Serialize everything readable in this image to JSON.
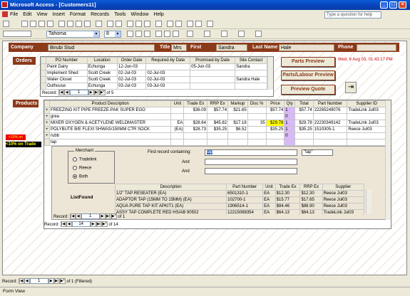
{
  "window": {
    "title": "Microsoft Access - [Customers11]"
  },
  "menu": [
    "File",
    "Edit",
    "View",
    "Insert",
    "Format",
    "Records",
    "Tools",
    "Window",
    "Help"
  ],
  "help_placeholder": "Type a question for help",
  "toolbar": {
    "font": "Tahoma",
    "size": "8"
  },
  "header": {
    "company_label": "Company Name",
    "company": "Birubi Stud",
    "title_label": "Title",
    "title": "Mrs",
    "first_label": "First Name",
    "first": "Sandra",
    "last_label": "Last Name",
    "last": "Hale",
    "phone_label": "Phone",
    "phone": ""
  },
  "orders": {
    "label": "Orders",
    "columns": [
      "PO Number",
      "Location",
      "Order Date",
      "Required-by Date",
      "Promised-by Date",
      "Site Contact"
    ],
    "rows": [
      [
        "Paint Dairy",
        "Echunga",
        "12-Jun-03",
        "",
        "05-Jun-03",
        "Sandra"
      ],
      [
        "Implement Shed",
        "Scott Creek",
        "02-Jul-03",
        "02-Jul-03",
        "",
        ""
      ],
      [
        "Water Closet",
        "Scott Creek",
        "02-Jul-03",
        "02-Jul-03",
        "",
        "Sandra Hale"
      ],
      [
        "Outhouse",
        "Echunga",
        "03-Jul-03",
        "03-Jul-03",
        "",
        ""
      ]
    ],
    "nav": {
      "record_label": "Record:",
      "current": "1",
      "of": "of 5"
    }
  },
  "buttons": {
    "parts_preview": "Parts Preview",
    "parts_labour": "Parts/Labour Preview",
    "preview_quote": "Preview Quote"
  },
  "datetime": "Wed, 6 Aug 03, 01:43:17 PM",
  "products": {
    "label": "Products",
    "columns": [
      "Product Description",
      "Unit",
      "Trade Ex",
      "RRP Ex",
      "Markup",
      "Disc %",
      "Price",
      "Qty",
      "Total",
      "Part Number",
      "Supplier ID"
    ],
    "rows": [
      [
        "FREEZING KIT PIPE FREEZE-PAK SUPER EGO",
        "",
        "$36.09",
        "$57.74",
        "$21.65",
        "",
        "$57.74",
        "1",
        "$57.74",
        "22265249076",
        "TradeLink Jul03"
      ],
      [
        "grea",
        "",
        "",
        "",
        "",
        "",
        "",
        "0",
        "",
        "",
        ""
      ],
      [
        "MIXER OXYGEN & ACETYLENE WELDMASTER",
        "EA",
        "$28.64",
        "$45.82",
        "$17.18",
        "35",
        "$29.78",
        "1",
        "$29.78",
        "22230349142",
        "TradeLink Jul03"
      ],
      [
        "POLYBUTE B/E FLEXI SHWAS/150MM CTR SOCK",
        "(EA)",
        "$28.73",
        "$35.25",
        "$6.52",
        "",
        "$35.25",
        "1",
        "$35.25",
        "1510305-1",
        "Reece Jul03"
      ],
      [
        "rubb",
        "",
        "",
        "",
        "",
        "",
        "",
        "0",
        "",
        "",
        ""
      ],
      [
        "tap",
        "",
        "",
        "",
        "",
        "",
        "",
        "",
        "",
        "",
        ""
      ]
    ],
    "nav": {
      "record_label": "Record:",
      "current": "14",
      "of": "of 14"
    }
  },
  "side_flags": [
    "<10% on Trade",
    "<10% on Trade"
  ],
  "merchant": {
    "label": "Merchant",
    "options": [
      "Tradelink",
      "Reece",
      "Both"
    ],
    "selected": "Both"
  },
  "find": {
    "label": "Find record containing:",
    "value": "tap",
    "and1": "And",
    "and2": "And",
    "quoted": "\"tap\""
  },
  "listfound": {
    "label": "ListFound",
    "columns": [
      "Description",
      "Part Number",
      "Unit",
      "Trade Ex",
      "RRP Ex",
      "Supplier"
    ],
    "rows": [
      [
        "1/2\" TAP RESEATER (EA)",
        "6501310-1",
        "EA",
        "$12.30",
        "$12.30",
        "Reece Jul03"
      ],
      [
        "ADAPTOR TAP (15MM TO 15MM) (EA)",
        "102700-1",
        "EA",
        "$15.77",
        "$17.65",
        "Reece Jul03"
      ],
      [
        "AQUA PURE TAP KIT APKIT1 (EA)",
        "1906514-1",
        "EA",
        "$84.46",
        "$88.90",
        "Reece Jul03"
      ],
      [
        "ASSY TAP COMPLETE RED HS/AB 90502",
        "12215088354",
        "EA",
        "$64.13",
        "$64.13",
        "TradeLink Jul03"
      ],
      [
        "ASSY TAP COMPLETE BLUE HS/AB 90502",
        "12215088355",
        "EA",
        "$64.13",
        "$64.13",
        "TradeLink Jul03"
      ]
    ],
    "nav": {
      "record_label": "Record:",
      "current": "1",
      "of": "of 1"
    }
  },
  "bottom_nav": {
    "record_label": "Record:",
    "current": "1",
    "of": "of 1 (Filtered)"
  },
  "status": "Form View"
}
